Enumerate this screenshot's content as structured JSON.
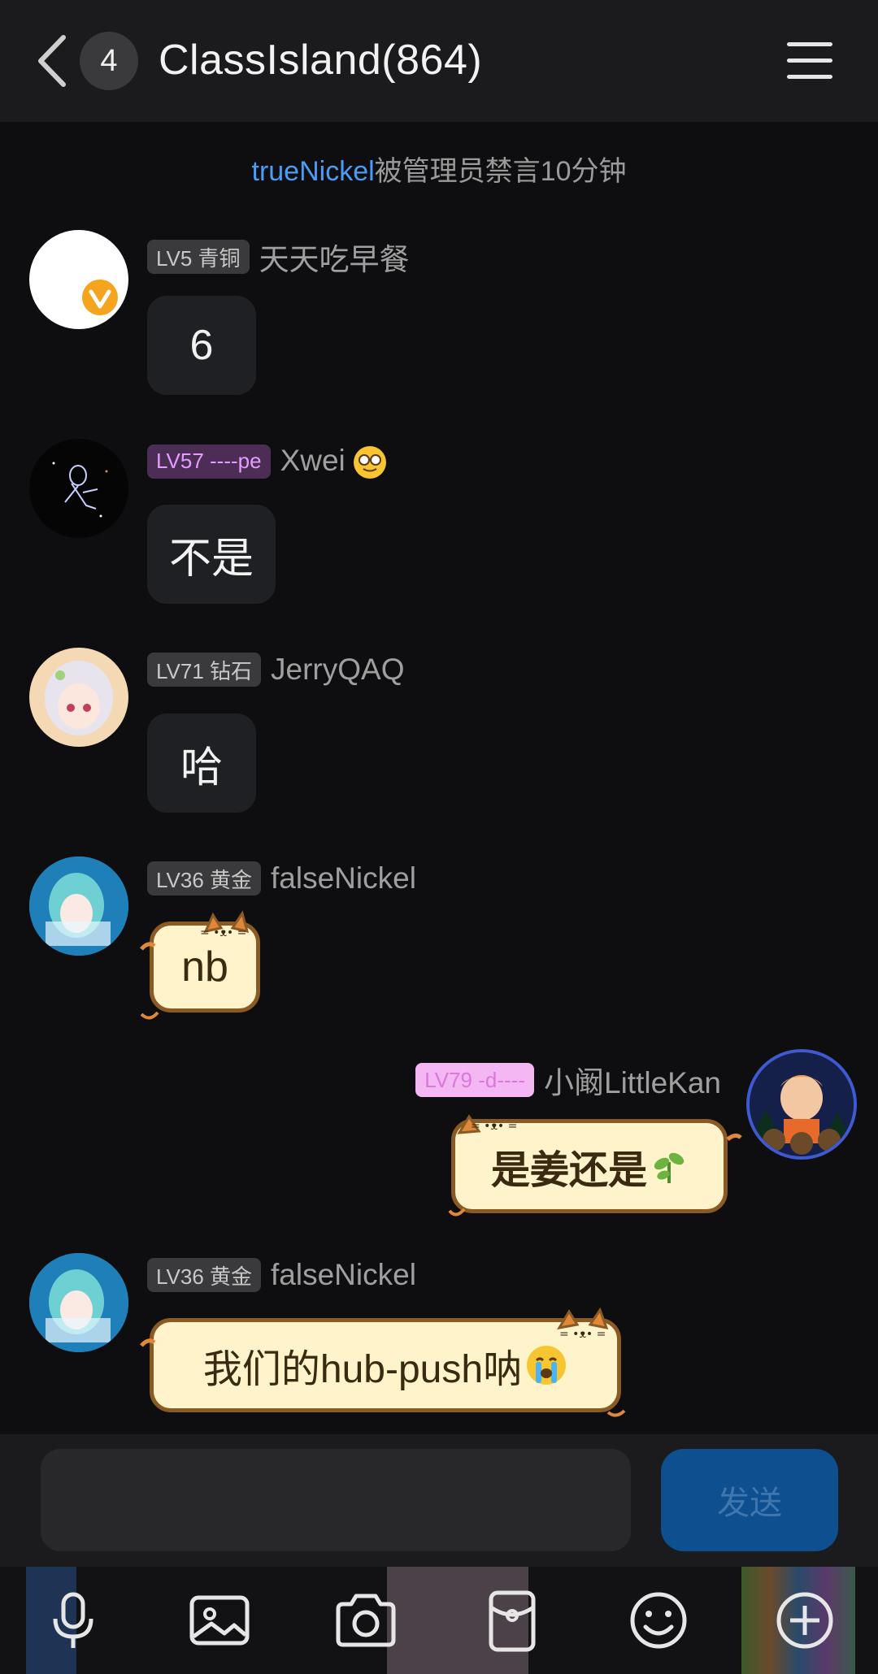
{
  "header": {
    "unread_count": "4",
    "title": "ClassIsland(864)"
  },
  "notice": {
    "user": "trueNickel",
    "text": "被管理员禁言10分钟"
  },
  "messages": [
    {
      "level": "LV5 青铜",
      "name": "天天吃早餐",
      "text": "6"
    },
    {
      "level": "LV57 ----pe",
      "name": "Xwei",
      "text": "不是"
    },
    {
      "level": "LV71 钻石",
      "name": "JerryQAQ",
      "text": "哈"
    },
    {
      "level": "LV36 黄金",
      "name": "falseNickel",
      "text": "nb"
    },
    {
      "level": "LV79 -d----",
      "name": "小阚LittleKan",
      "text": "是姜还是"
    },
    {
      "level": "LV36 黄金",
      "name": "falseNickel",
      "text": "我们的hub-push呐"
    }
  ],
  "composer": {
    "placeholder": "",
    "send_label": "发送"
  },
  "toolbar": {
    "icons": [
      "mic-icon",
      "image-icon",
      "camera-icon",
      "red-packet-icon",
      "emoji-icon",
      "plus-icon"
    ]
  },
  "colors": {
    "background": "#0e0e10",
    "header": "#1b1b1d",
    "bubble": "#1f2023",
    "link": "#4a9cf5",
    "send_button": "#0e4f8f",
    "cat_bubble": "#fff3cc"
  }
}
